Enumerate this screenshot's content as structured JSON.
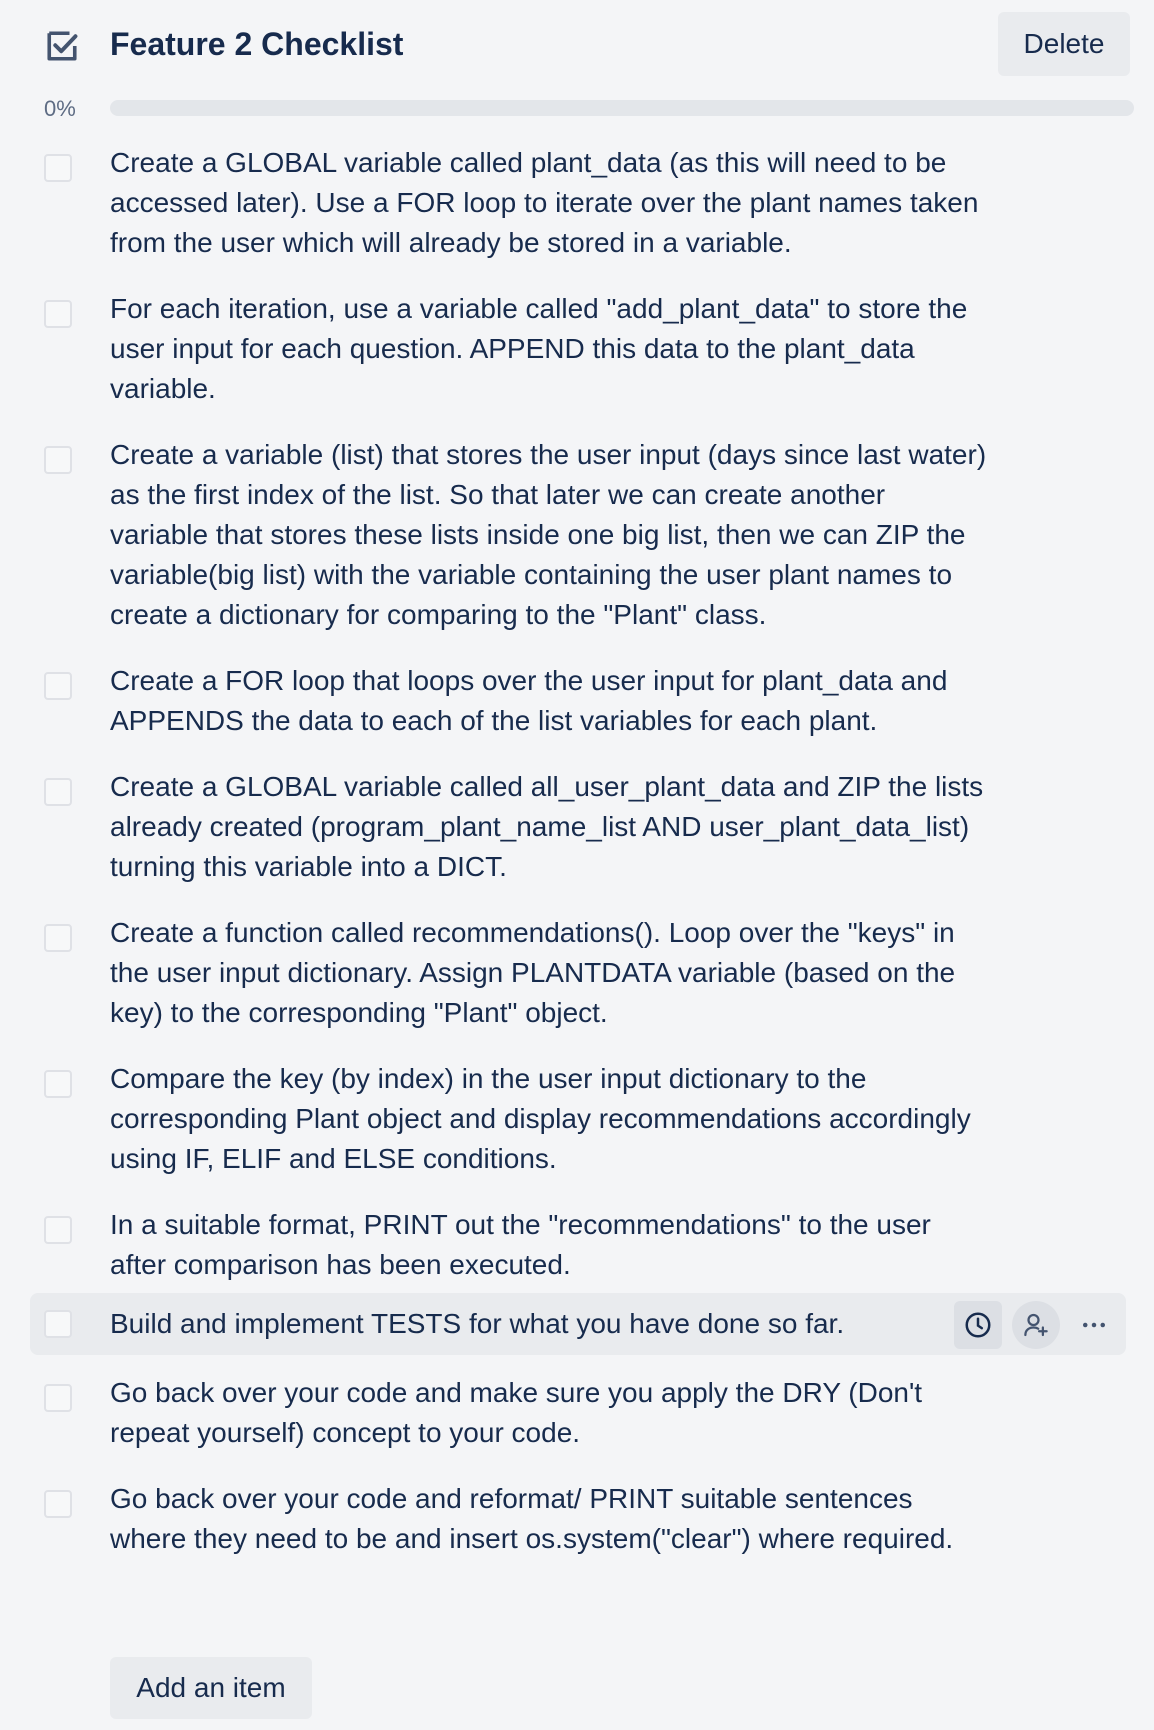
{
  "checklist": {
    "title": "Feature 2 Checklist",
    "delete_label": "Delete",
    "progress_label": "0%",
    "progress_value": 0,
    "add_item_label": "Add an item",
    "items": [
      {
        "text": "Create a GLOBAL variable called plant_data (as this will need to be accessed later). Use a FOR loop to iterate over the plant names taken from the user which will already be stored in a variable.",
        "checked": false
      },
      {
        "text": "For each iteration, use a variable called \"add_plant_data\" to store the user input for each question. APPEND this data to the plant_data variable.",
        "checked": false
      },
      {
        "text": "Create a variable (list) that stores the user input (days since last water) as the first index of the list. So that later we can create another variable that stores these lists inside one big list, then we can ZIP the variable(big list) with the variable containing the user plant names to create a dictionary for comparing to the \"Plant\" class.",
        "checked": false
      },
      {
        "text": "Create a FOR loop that loops over the user input for plant_data and APPENDS the data to each of the list variables for each plant.",
        "checked": false
      },
      {
        "text": "Create a GLOBAL variable called all_user_plant_data and ZIP the lists already created (program_plant_name_list AND user_plant_data_list) turning this variable into a DICT.",
        "checked": false
      },
      {
        "text": "Create a function called recommendations(). Loop over the \"keys\" in the user input dictionary. Assign PLANTDATA variable (based on the key) to the corresponding \"Plant\" object.",
        "checked": false
      },
      {
        "text": "Compare the key (by index) in the user input dictionary to the corresponding Plant object and display recommendations accordingly using IF, ELIF and ELSE conditions.",
        "checked": false
      },
      {
        "text": "In a suitable format, PRINT out the \"recommendations\" to the user after comparison has been executed.",
        "checked": false
      },
      {
        "text": "Build and implement TESTS for what you have done so far.",
        "checked": false
      },
      {
        "text": "Go back over your code and make sure you apply the DRY (Don't repeat yourself) concept to your code.",
        "checked": false
      },
      {
        "text": "Go back over your code and reformat/ PRINT suitable sentences where they need to be and insert os.system(\"clear\") where required.",
        "checked": false
      }
    ],
    "hovered_item_index": 8,
    "item_actions": [
      "clock-icon",
      "add-member-icon",
      "more-icon"
    ]
  },
  "colors": {
    "background": "#f4f5f7",
    "text": "#172b4d",
    "muted": "#5e6c84",
    "button_bg": "#e9ebee",
    "progress_track": "#e3e6ea"
  }
}
